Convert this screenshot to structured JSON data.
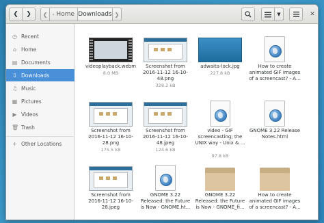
{
  "header": {
    "back_icon": "chevron-left-icon",
    "forward_icon": "chevron-right-icon",
    "path": {
      "home_label": "Home",
      "current_label": "Downloads"
    },
    "search_icon": "search-icon",
    "view_icon": "list-view-icon",
    "sort_icon": "chevron-down-icon",
    "menu_icon": "hamburger-menu-icon",
    "close_icon": "close-icon"
  },
  "sidebar": {
    "items": [
      {
        "label": "Recent",
        "icon": "clock-icon",
        "active": false
      },
      {
        "label": "Home",
        "icon": "home-icon",
        "active": false
      },
      {
        "label": "Documents",
        "icon": "document-icon",
        "active": false
      },
      {
        "label": "Downloads",
        "icon": "download-icon",
        "active": true
      },
      {
        "label": "Music",
        "icon": "music-icon",
        "active": false
      },
      {
        "label": "Pictures",
        "icon": "picture-icon",
        "active": false
      },
      {
        "label": "Videos",
        "icon": "video-icon",
        "active": false
      },
      {
        "label": "Trash",
        "icon": "trash-icon",
        "active": false
      }
    ],
    "other": {
      "label": "Other Locations",
      "icon": "plus-icon"
    }
  },
  "files": [
    {
      "name": "videoplayback.webm",
      "size": "8.0 MB",
      "kind": "video"
    },
    {
      "name": "Screenshot from 2016-11-12 16-10-48.png",
      "size": "328.2 kB",
      "kind": "shot"
    },
    {
      "name": "adwaita-lock.jpg",
      "size": "227.8 kB",
      "kind": "lock"
    },
    {
      "name": "How to create animated GIF images of a screencast? - A...",
      "size": "",
      "kind": "html"
    },
    {
      "name": "Screenshot from 2016-11-12 16-10-28.png",
      "size": "175.5 kB",
      "kind": "shot"
    },
    {
      "name": "Screenshot from 2016-11-12 16-10-48.jpeg",
      "size": "124.6 kB",
      "kind": "shot"
    },
    {
      "name": "video - GIF screencasting; the UNIX way - Unix & ...",
      "size": "97.8 kB",
      "kind": "html"
    },
    {
      "name": "GNOME 3.22 Release Notes.html",
      "size": "",
      "kind": "html"
    },
    {
      "name": "Screenshot from 2016-11-12 16-10-28.jpeg",
      "size": "",
      "kind": "shot"
    },
    {
      "name": "GNOME 3.22 Released: the Future is Now - GNOME.ht...",
      "size": "",
      "kind": "html"
    },
    {
      "name": "GNOME 3.22 Released: the Future is Now - GNOME_fi...",
      "size": "",
      "kind": "folder"
    },
    {
      "name": "How to create animated GIF images of a screencast? - A...",
      "size": "",
      "kind": "folder"
    }
  ],
  "colors": {
    "accent": "#4a90d9",
    "background": "#2f86bb"
  }
}
